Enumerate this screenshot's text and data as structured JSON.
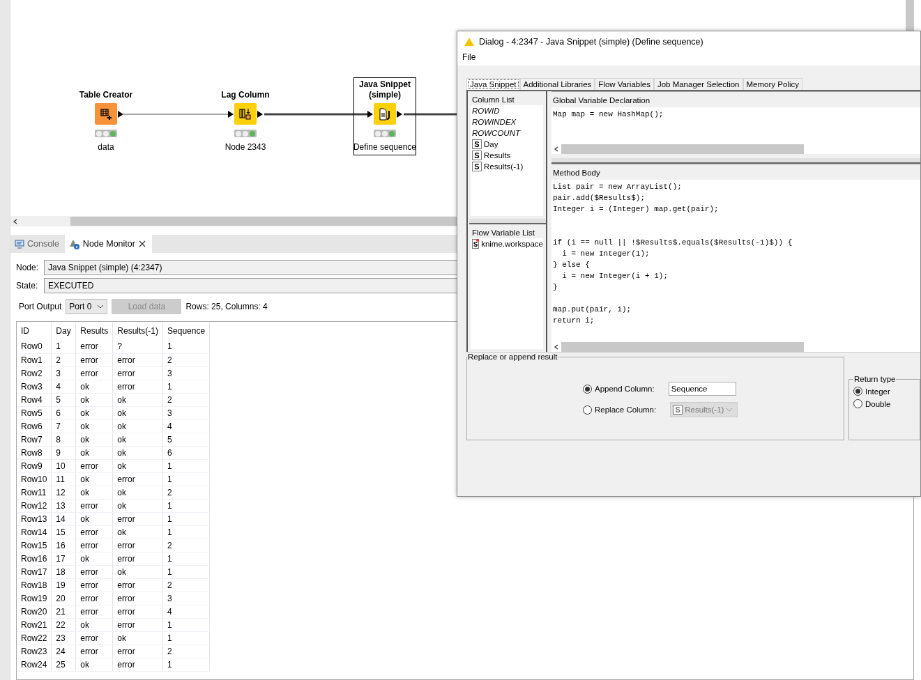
{
  "workflow": {
    "nodes": [
      {
        "title": "Table Creator",
        "caption": "data",
        "kind": "source",
        "selected": false
      },
      {
        "title": "Lag Column",
        "caption": "Node 2343",
        "kind": "manipulator",
        "selected": false
      },
      {
        "title": "Java Snippet (simple)",
        "caption": "Define sequence",
        "kind": "snippet",
        "selected": true
      }
    ]
  },
  "bottom_panel": {
    "tabs": [
      {
        "label": "Console",
        "selected": false,
        "closable": false
      },
      {
        "label": "Node Monitor",
        "selected": true,
        "closable": true
      }
    ],
    "node_label": "Node:",
    "node_value": "Java Snippet (simple)  (4:2347)",
    "state_label": "State:",
    "state_value": "EXECUTED",
    "port_label": "Port Output",
    "port_value": "Port 0",
    "load_button": "Load data",
    "summary": "Rows: 25, Columns: 4",
    "table": {
      "columns": [
        "ID",
        "Day",
        "Results",
        "Results(-1)",
        "Sequence"
      ],
      "rows": [
        [
          "Row0",
          "1",
          "error",
          "?",
          "1"
        ],
        [
          "Row1",
          "2",
          "error",
          "error",
          "2"
        ],
        [
          "Row2",
          "3",
          "error",
          "error",
          "3"
        ],
        [
          "Row3",
          "4",
          "ok",
          "error",
          "1"
        ],
        [
          "Row4",
          "5",
          "ok",
          "ok",
          "2"
        ],
        [
          "Row5",
          "6",
          "ok",
          "ok",
          "3"
        ],
        [
          "Row6",
          "7",
          "ok",
          "ok",
          "4"
        ],
        [
          "Row7",
          "8",
          "ok",
          "ok",
          "5"
        ],
        [
          "Row8",
          "9",
          "ok",
          "ok",
          "6"
        ],
        [
          "Row9",
          "10",
          "error",
          "ok",
          "1"
        ],
        [
          "Row10",
          "11",
          "ok",
          "error",
          "1"
        ],
        [
          "Row11",
          "12",
          "ok",
          "ok",
          "2"
        ],
        [
          "Row12",
          "13",
          "error",
          "ok",
          "1"
        ],
        [
          "Row13",
          "14",
          "ok",
          "error",
          "1"
        ],
        [
          "Row14",
          "15",
          "error",
          "ok",
          "1"
        ],
        [
          "Row15",
          "16",
          "error",
          "error",
          "2"
        ],
        [
          "Row16",
          "17",
          "ok",
          "error",
          "1"
        ],
        [
          "Row17",
          "18",
          "error",
          "ok",
          "1"
        ],
        [
          "Row18",
          "19",
          "error",
          "error",
          "2"
        ],
        [
          "Row19",
          "20",
          "error",
          "error",
          "3"
        ],
        [
          "Row20",
          "21",
          "error",
          "error",
          "4"
        ],
        [
          "Row21",
          "22",
          "ok",
          "error",
          "1"
        ],
        [
          "Row22",
          "23",
          "error",
          "ok",
          "1"
        ],
        [
          "Row23",
          "24",
          "error",
          "error",
          "2"
        ],
        [
          "Row24",
          "25",
          "ok",
          "error",
          "1"
        ]
      ]
    }
  },
  "dialog": {
    "title": "Dialog - 4:2347 - Java Snippet (simple) (Define sequence)",
    "menu": [
      "File"
    ],
    "tabs": [
      {
        "label": "Java Snippet",
        "selected": true
      },
      {
        "label": "Additional Libraries",
        "selected": false
      },
      {
        "label": "Flow Variables",
        "selected": false
      },
      {
        "label": "Job Manager Selection",
        "selected": false
      },
      {
        "label": "Memory Policy",
        "selected": false
      }
    ],
    "column_list": {
      "title": "Column List",
      "items": [
        {
          "label": "ROWID",
          "kind": "field"
        },
        {
          "label": "ROWINDEX",
          "kind": "field"
        },
        {
          "label": "ROWCOUNT",
          "kind": "field"
        },
        {
          "label": "Day",
          "kind": "column",
          "type_icon": "S"
        },
        {
          "label": "Results",
          "kind": "column",
          "type_icon": "S"
        },
        {
          "label": "Results(-1)",
          "kind": "column",
          "type_icon": "S"
        }
      ]
    },
    "flow_variable_list": {
      "title": "Flow Variable List",
      "items": [
        {
          "label": "knime.workspace",
          "type_icon": "s"
        }
      ]
    },
    "global_declaration": {
      "title": "Global Variable Declaration",
      "code": "Map map = new HashMap();"
    },
    "method_body": {
      "title": "Method Body",
      "code": "List pair = new ArrayList();\npair.add($Results$);\nInteger i = (Integer) map.get(pair);\n\n\nif (i == null || !$Results$.equals($Results(-1)$)) {\n  i = new Integer(1);\n} else {\n  i = new Integer(i + 1);\n}\n\nmap.put(pair, i);\nreturn i;"
    },
    "result_group": {
      "title": "Replace or append result",
      "options": [
        {
          "label": "Append Column:",
          "selected": true,
          "kind": "text",
          "value": "Sequence"
        },
        {
          "label": "Replace Column:",
          "selected": false,
          "kind": "select",
          "value": "Results(-1)",
          "type_icon": "S"
        }
      ]
    },
    "return_type": {
      "title": "Return type",
      "options": [
        {
          "label": "Integer",
          "selected": true
        },
        {
          "label": "Double",
          "selected": false
        }
      ]
    }
  }
}
